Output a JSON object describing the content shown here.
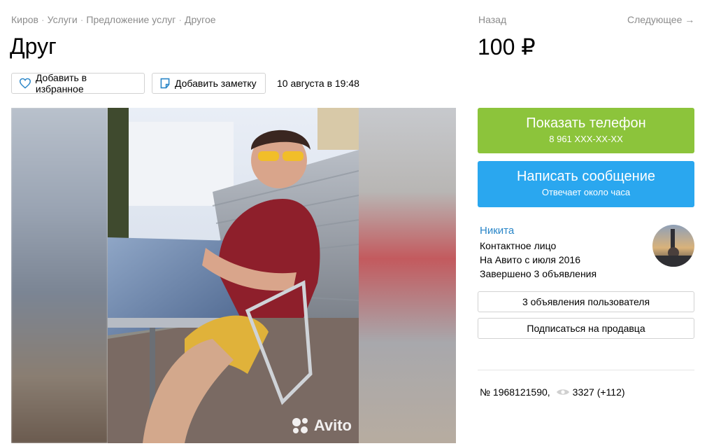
{
  "breadcrumb": {
    "items": [
      "Киров",
      "Услуги",
      "Предложение услуг",
      "Другое"
    ],
    "separator": "·"
  },
  "listing": {
    "title": "Друг",
    "price": "100 ₽",
    "date": "10 августа в 19:48",
    "id_text": "№ 1968121590,",
    "views": "3327 (+112)"
  },
  "nav": {
    "back": "Назад",
    "next": "Следующее →"
  },
  "actions": {
    "favorite": "Добавить в избранное",
    "note": "Добавить заметку"
  },
  "contact": {
    "show_phone": "Показать телефон",
    "phone": "8 961 XXX-XX-XX",
    "write_message": "Написать сообщение",
    "response_time": "Отвечает около часа"
  },
  "seller": {
    "name": "Никита",
    "role": "Контактное лицо",
    "since": "На Авито с июля 2016",
    "completed": "Завершено 3 объявления",
    "ads_button": "3 объявления пользователя",
    "subscribe_button": "Подписаться на продавца"
  },
  "gallery": {
    "watermark": "Avito"
  },
  "colors": {
    "green": "#8cc43b",
    "blue": "#2aa7ef",
    "link": "#2a86c8"
  }
}
